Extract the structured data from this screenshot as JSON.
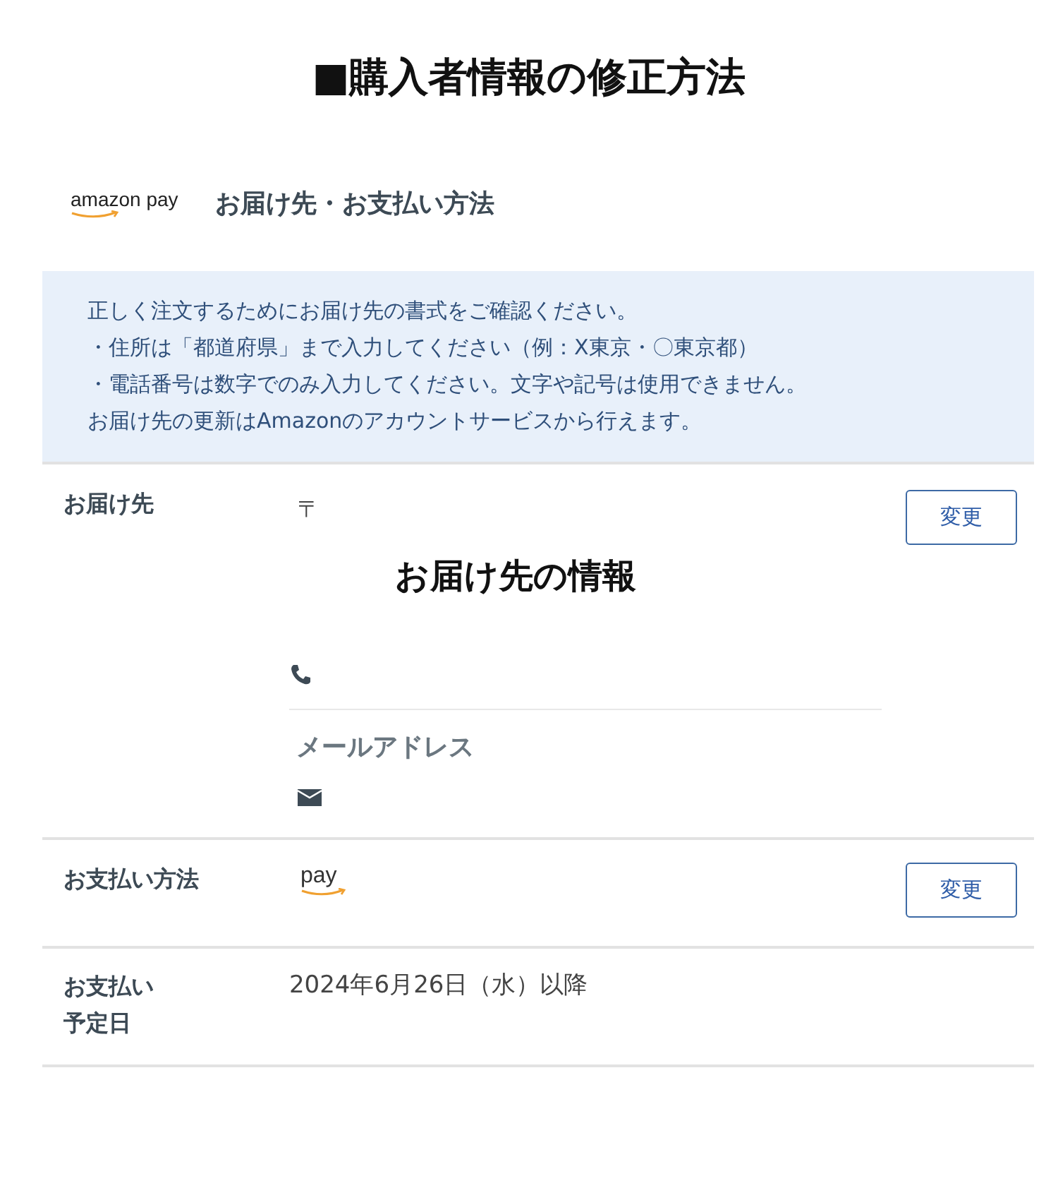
{
  "title": "■購入者情報の修正方法",
  "header": {
    "logo": "amazon pay",
    "heading": "お届け先・お支払い方法"
  },
  "notice": [
    "正しく注文するためにお届け先の書式をご確認ください。",
    "・住所は「都道府県」まで入力してください（例：X東京・〇東京都）",
    "・電話番号は数字でのみ入力してください。文字や記号は使用できません。",
    "お届け先の更新はAmazonのアカウントサービスから行えます。"
  ],
  "shipping": {
    "label": "お届け先",
    "postal_mark": "〒",
    "info_heading": "お届け先の情報",
    "email_label": "メールアドレス",
    "button": "変更"
  },
  "payment": {
    "label": "お支払い方法",
    "logo": "pay",
    "button": "変更"
  },
  "schedule": {
    "label": "お支払い予定日",
    "value": "2024年6月26日（水）以降"
  }
}
